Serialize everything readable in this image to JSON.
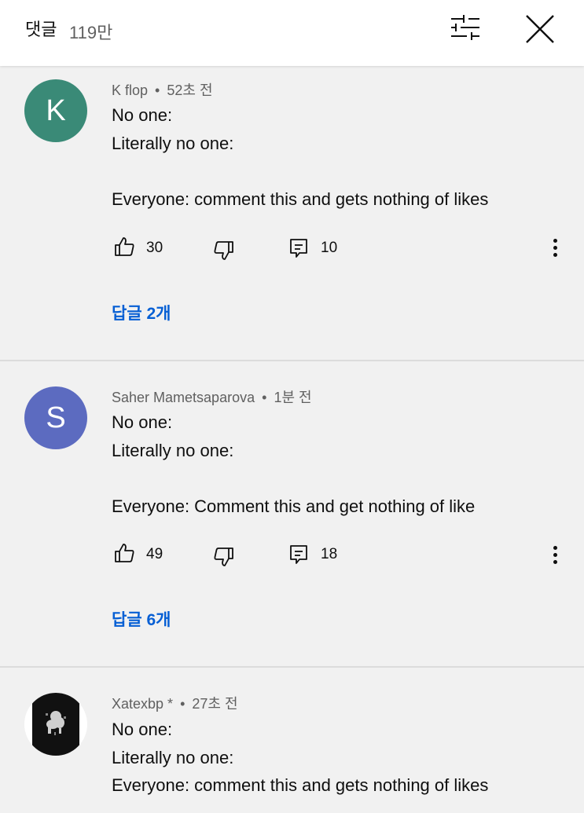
{
  "header": {
    "title": "댓글",
    "count": "119만"
  },
  "comments": [
    {
      "avatar_letter": "K",
      "avatar_color": "#3a8a77",
      "author": "K flop",
      "separator": "•",
      "time": "52초 전",
      "lines": [
        "No one:",
        "Literally no one:",
        "Everyone: comment this and gets nothing of likes"
      ],
      "likes": "30",
      "reply_count": "10",
      "replies_label": "답글 2개"
    },
    {
      "avatar_letter": "S",
      "avatar_color": "#5c6bc0",
      "author": "Saher Mametsaparova",
      "separator": "•",
      "time": "1분 전",
      "lines": [
        "No one:",
        "Literally no one:",
        "Everyone: Comment this and get nothing of like"
      ],
      "likes": "49",
      "reply_count": "18",
      "replies_label": "답글 6개"
    },
    {
      "avatar_color": "#111111",
      "author": "Xatexbp *",
      "separator": "•",
      "time": "27초 전",
      "lines": [
        "No one:",
        "Literally no one:",
        "Everyone: comment this and gets nothing of likes"
      ]
    }
  ]
}
